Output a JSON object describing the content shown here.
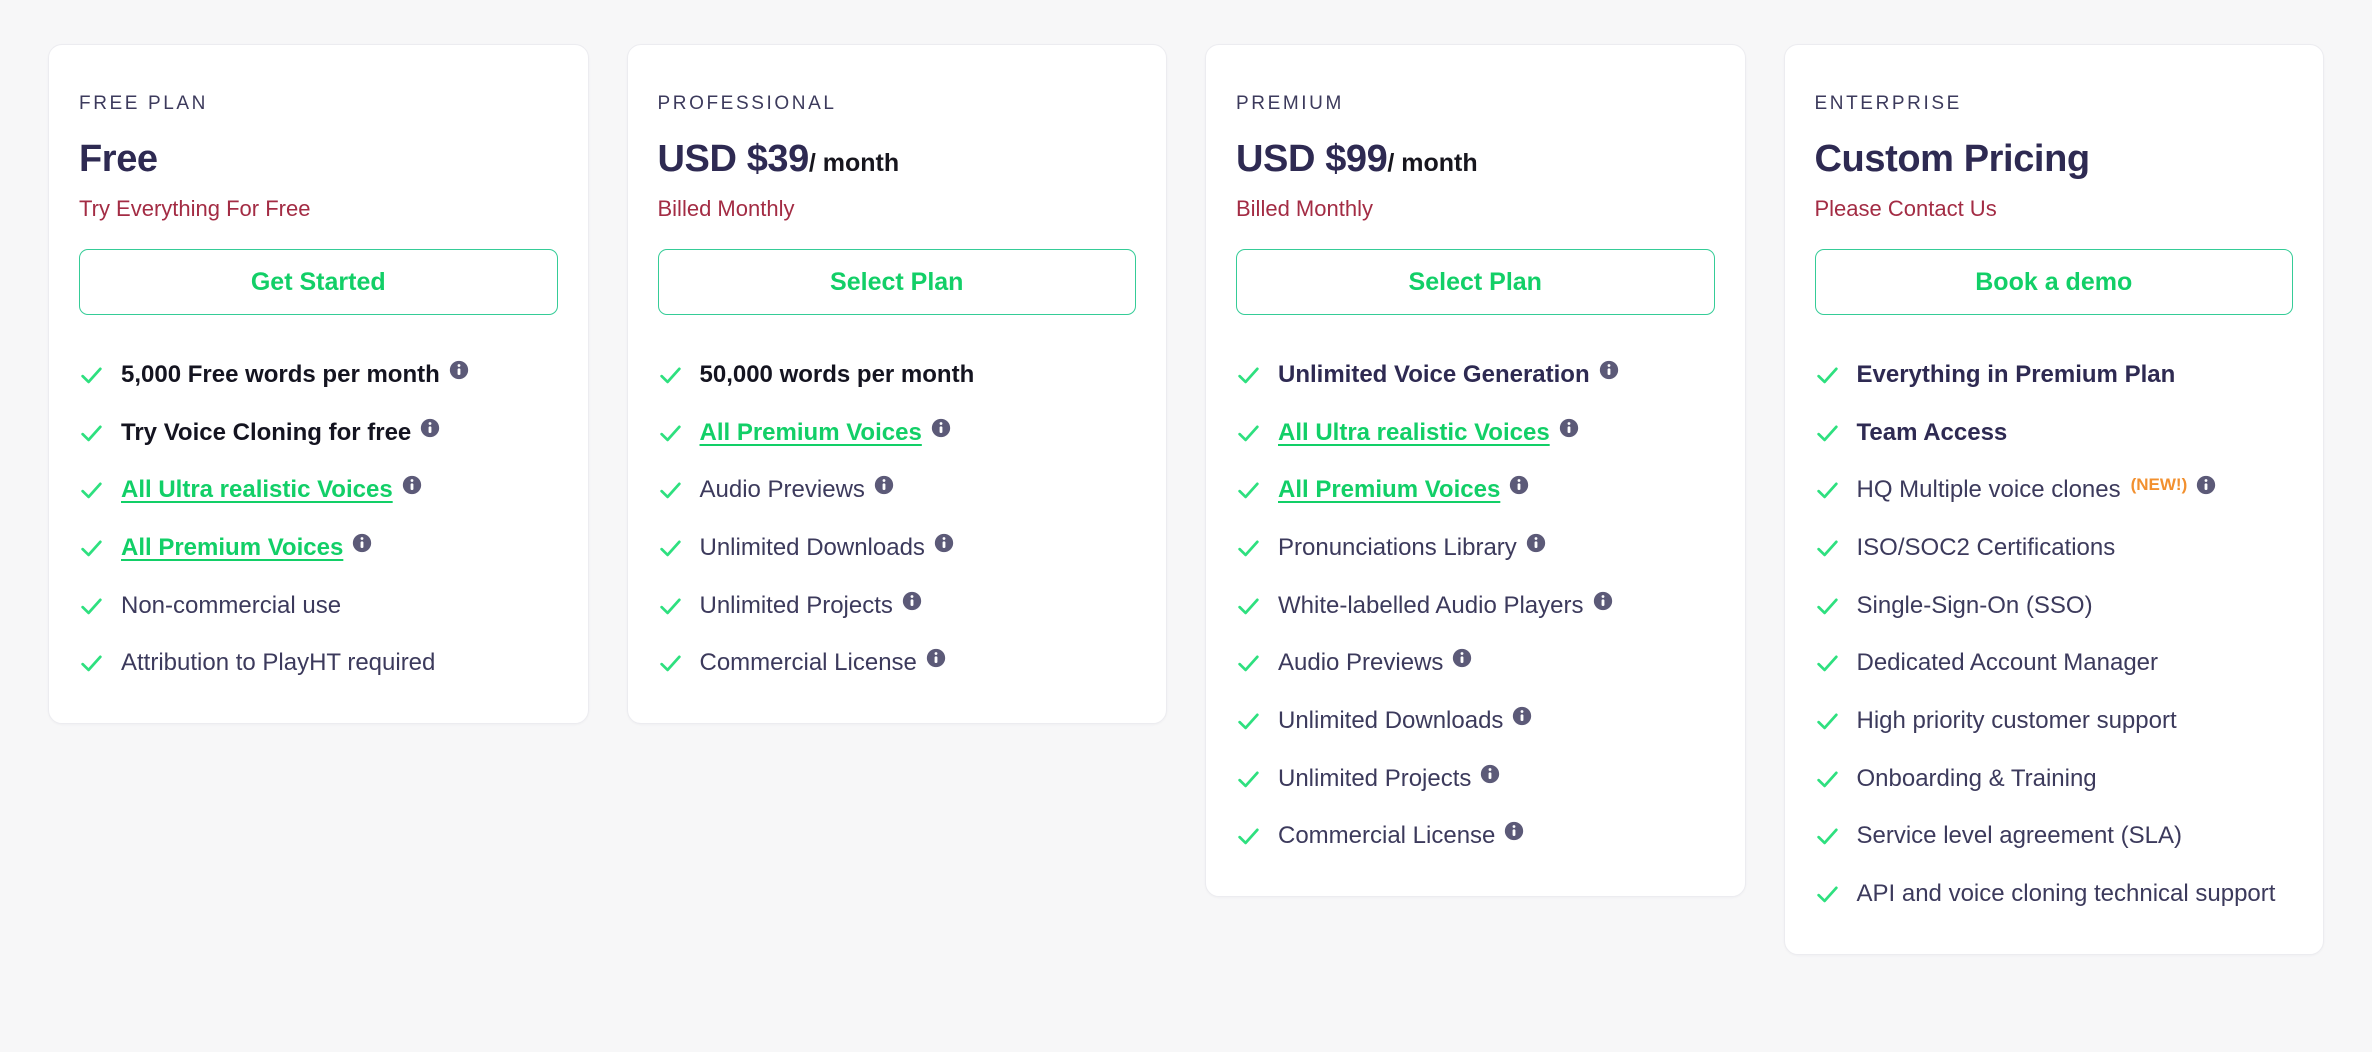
{
  "theme": {
    "page_bg": "#f7f7f8",
    "card_bg": "#ffffff",
    "accent_green": "#12cf67",
    "button_border_green": "#35cc97",
    "check_green": "#2ee07f",
    "navy": "#2e2a52",
    "maroon": "#a32c44",
    "info_icon_gray": "#5c5a78",
    "new_badge_orange": "#f2902f"
  },
  "icons": {
    "check": "check-icon",
    "info": "info-icon"
  },
  "plans": [
    {
      "eyebrow": "FREE PLAN",
      "price": "Free",
      "price_period": "",
      "subtitle": "Try Everything For Free",
      "cta_label": "Get Started",
      "features": [
        {
          "text": "5,000 Free words per month",
          "style": "bold",
          "info": true
        },
        {
          "text": "Try Voice Cloning for free",
          "style": "bold",
          "info": true
        },
        {
          "text": "All Ultra realistic Voices",
          "style": "link",
          "info": true
        },
        {
          "text": "All Premium Voices",
          "style": "link",
          "info": true
        },
        {
          "text": "Non-commercial use",
          "style": "normal",
          "info": false
        },
        {
          "text": "Attribution to PlayHT required",
          "style": "normal",
          "info": false
        }
      ]
    },
    {
      "eyebrow": "PROFESSIONAL",
      "price": "USD $39",
      "price_period": "/ month",
      "subtitle": "Billed Monthly",
      "cta_label": "Select Plan",
      "features": [
        {
          "text": "50,000 words per month",
          "style": "bold",
          "info": false
        },
        {
          "text": "All Premium Voices",
          "style": "link",
          "info": true
        },
        {
          "text": "Audio Previews",
          "style": "normal",
          "info": true
        },
        {
          "text": "Unlimited Downloads",
          "style": "normal",
          "info": true
        },
        {
          "text": "Unlimited Projects",
          "style": "normal",
          "info": true
        },
        {
          "text": "Commercial License",
          "style": "normal",
          "info": true
        }
      ]
    },
    {
      "eyebrow": "PREMIUM",
      "price": "USD $99",
      "price_period": "/ month",
      "subtitle": "Billed Monthly",
      "cta_label": "Select Plan",
      "features": [
        {
          "text": "Unlimited Voice Generation",
          "style": "bold-navy",
          "info": true
        },
        {
          "text": "All Ultra realistic Voices",
          "style": "link",
          "info": true
        },
        {
          "text": "All Premium Voices",
          "style": "link",
          "info": true
        },
        {
          "text": "Pronunciations Library",
          "style": "normal",
          "info": true
        },
        {
          "text": "White-labelled Audio Players",
          "style": "normal",
          "info": true
        },
        {
          "text": "Audio Previews",
          "style": "normal",
          "info": true
        },
        {
          "text": "Unlimited Downloads",
          "style": "normal",
          "info": true
        },
        {
          "text": "Unlimited Projects",
          "style": "normal",
          "info": true
        },
        {
          "text": "Commercial License",
          "style": "normal",
          "info": true
        }
      ]
    },
    {
      "eyebrow": "ENTERPRISE",
      "price": "Custom Pricing",
      "price_period": "",
      "subtitle": "Please Contact Us",
      "cta_label": "Book a demo",
      "features": [
        {
          "text": "Everything in Premium Plan",
          "style": "bold-navy",
          "info": false
        },
        {
          "text": "Team Access",
          "style": "bold-navy",
          "info": false
        },
        {
          "text": "HQ Multiple voice clones",
          "style": "normal",
          "info": true,
          "badge": "(NEW!)"
        },
        {
          "text": "ISO/SOC2 Certifications",
          "style": "normal",
          "info": false
        },
        {
          "text": "Single-Sign-On (SSO)",
          "style": "normal",
          "info": false
        },
        {
          "text": "Dedicated Account Manager",
          "style": "normal",
          "info": false
        },
        {
          "text": "High priority customer support",
          "style": "normal",
          "info": false
        },
        {
          "text": "Onboarding & Training",
          "style": "normal",
          "info": false
        },
        {
          "text": "Service level agreement (SLA)",
          "style": "normal",
          "info": false
        },
        {
          "text": "API and voice cloning technical support",
          "style": "normal",
          "info": false
        }
      ]
    }
  ]
}
